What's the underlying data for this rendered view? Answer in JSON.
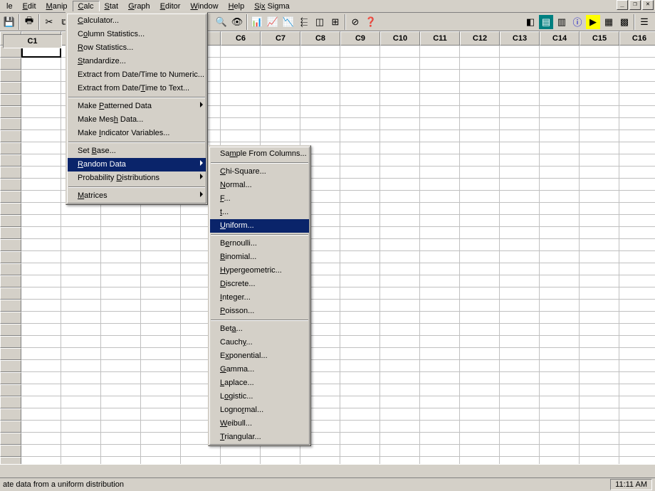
{
  "menubar": {
    "items": [
      {
        "label": "le",
        "u": ""
      },
      {
        "label": "Edit",
        "u": "E"
      },
      {
        "label": "Manip",
        "u": "M"
      },
      {
        "label": "Calc",
        "u": "C"
      },
      {
        "label": "Stat",
        "u": "S"
      },
      {
        "label": "Graph",
        "u": "G"
      },
      {
        "label": "Editor",
        "u": "E"
      },
      {
        "label": "Window",
        "u": "W"
      },
      {
        "label": "Help",
        "u": "H"
      },
      {
        "label": "Six Sigma",
        "u": "S"
      }
    ]
  },
  "window_controls": {
    "minimize": "_",
    "restore": "❐",
    "close": "✕"
  },
  "cell_reference": "C1",
  "columns": [
    "C1",
    "",
    "",
    "",
    "",
    "C6",
    "C7",
    "C8",
    "C9",
    "C10",
    "C11",
    "C12",
    "C13",
    "C14",
    "C15",
    "C16"
  ],
  "calc_menu": {
    "items": [
      {
        "label": "Calculator...",
        "u": "C"
      },
      {
        "label": "Column Statistics...",
        "u": "o"
      },
      {
        "label": "Row Statistics...",
        "u": "R"
      },
      {
        "label": "Standardize...",
        "u": "S"
      },
      {
        "label": "Extract from Date/Time to Numeric...",
        "u": ""
      },
      {
        "label": "Extract from Date/Time to Text...",
        "u": "T"
      },
      {
        "sep": true
      },
      {
        "label": "Make Patterned Data",
        "u": "P",
        "submenu": true
      },
      {
        "label": "Make Mesh Data...",
        "u": "h"
      },
      {
        "label": "Make Indicator Variables...",
        "u": "I"
      },
      {
        "sep": true
      },
      {
        "label": "Set Base...",
        "u": "B"
      },
      {
        "label": "Random Data",
        "u": "R",
        "submenu": true,
        "highlighted": true
      },
      {
        "label": "Probability Distributions",
        "u": "D",
        "submenu": true
      },
      {
        "sep": true
      },
      {
        "label": "Matrices",
        "u": "M",
        "submenu": true
      }
    ]
  },
  "random_submenu": {
    "items": [
      {
        "label": "Sample From Columns...",
        "u": "m"
      },
      {
        "sep": true
      },
      {
        "label": "Chi-Square...",
        "u": "C"
      },
      {
        "label": "Normal...",
        "u": "N"
      },
      {
        "label": "F...",
        "u": "F"
      },
      {
        "label": "t...",
        "u": "t"
      },
      {
        "label": "Uniform...",
        "u": "U",
        "highlighted": true
      },
      {
        "sep": true
      },
      {
        "label": "Bernoulli...",
        "u": "e"
      },
      {
        "label": "Binomial...",
        "u": "B"
      },
      {
        "label": "Hypergeometric...",
        "u": "H"
      },
      {
        "label": "Discrete...",
        "u": "D"
      },
      {
        "label": "Integer...",
        "u": "I"
      },
      {
        "label": "Poisson...",
        "u": "P"
      },
      {
        "sep": true
      },
      {
        "label": "Beta...",
        "u": "a"
      },
      {
        "label": "Cauchy...",
        "u": "y"
      },
      {
        "label": "Exponential...",
        "u": "x"
      },
      {
        "label": "Gamma...",
        "u": "G"
      },
      {
        "label": "Laplace...",
        "u": "L"
      },
      {
        "label": "Logistic...",
        "u": "o"
      },
      {
        "label": "Lognormal...",
        "u": "r"
      },
      {
        "label": "Weibull...",
        "u": "W"
      },
      {
        "label": "Triangular...",
        "u": "T"
      }
    ]
  },
  "status": {
    "text": "ate data from a uniform distribution",
    "time": "11:11 AM"
  }
}
